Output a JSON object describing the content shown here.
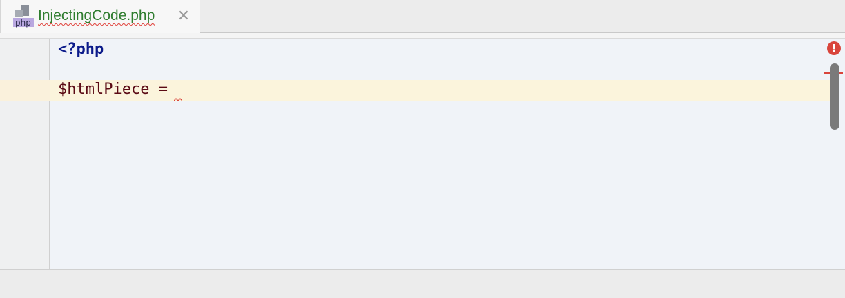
{
  "tab": {
    "file_name": "InjectingCode.php",
    "icon_label": "php",
    "close_glyph": "✕"
  },
  "editor": {
    "lines": [
      "<?php",
      "$htmlPiece ="
    ]
  },
  "markers": {
    "error_glyph": "!"
  },
  "colors": {
    "editor_bg": "#f0f3f8",
    "current_line": "#fbf4dc",
    "keyword": "#0b1a8a",
    "variable": "#5a0a14",
    "error": "#d9453c",
    "file_name": "#2f7d2f"
  }
}
